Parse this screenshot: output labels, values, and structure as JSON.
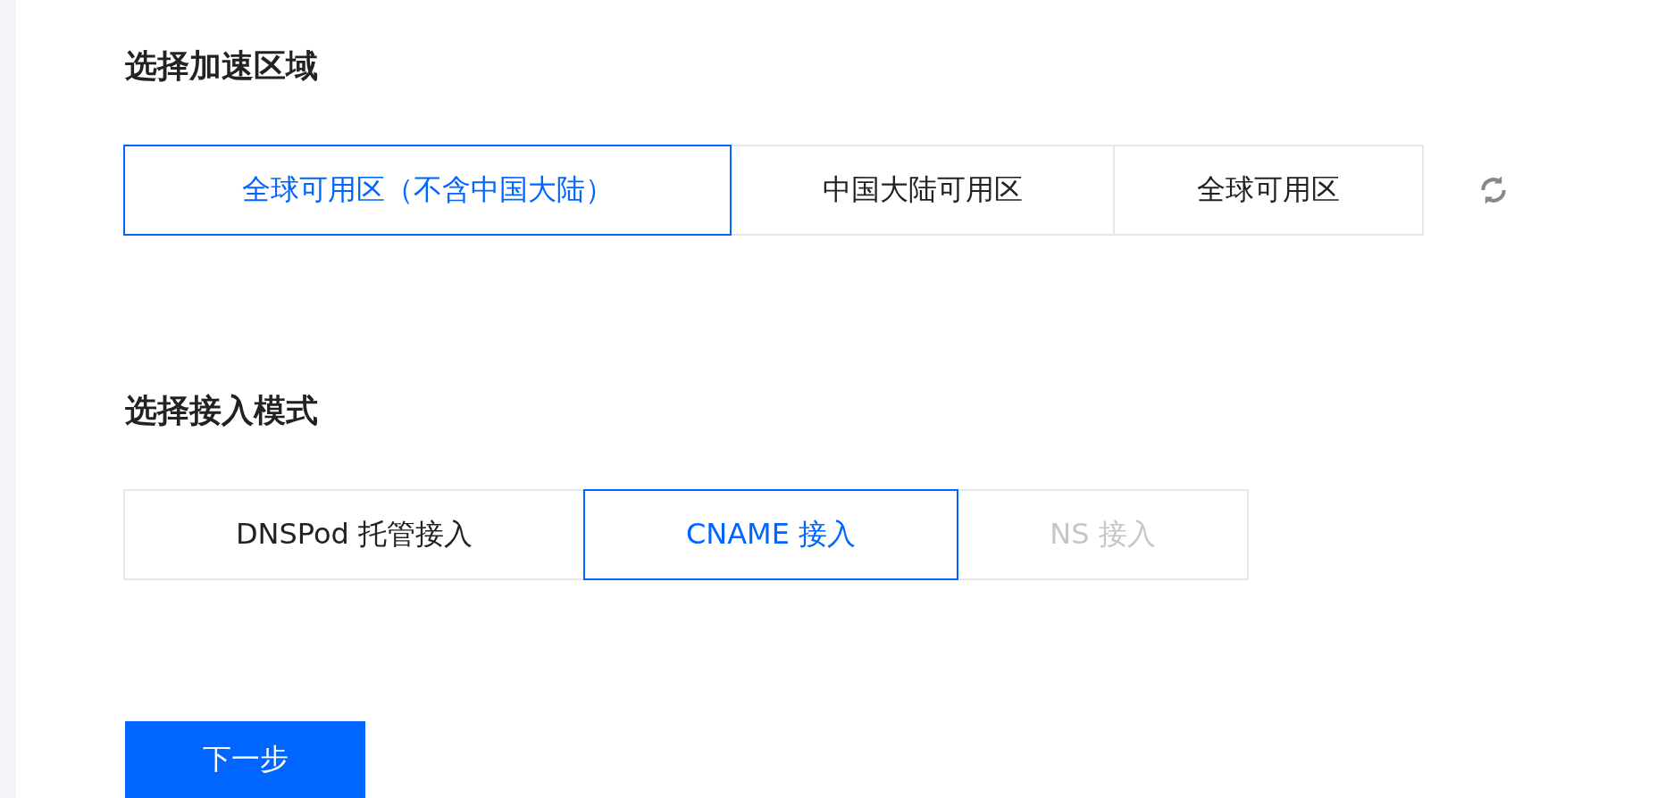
{
  "sections": [
    {
      "title": "选择加速区域",
      "options": [
        {
          "label": "全球可用区（不含中国大陆）",
          "selected": true,
          "disabled": false
        },
        {
          "label": "中国大陆可用区",
          "selected": false,
          "disabled": false
        },
        {
          "label": "全球可用区",
          "selected": false,
          "disabled": false
        }
      ],
      "refresh": true
    },
    {
      "title": "选择接入模式",
      "options": [
        {
          "label": "DNSPod 托管接入",
          "selected": false,
          "disabled": false
        },
        {
          "label": "CNAME 接入",
          "selected": true,
          "disabled": false
        },
        {
          "label": "NS 接入",
          "selected": false,
          "disabled": true
        }
      ]
    }
  ],
  "next_button": "下一步"
}
